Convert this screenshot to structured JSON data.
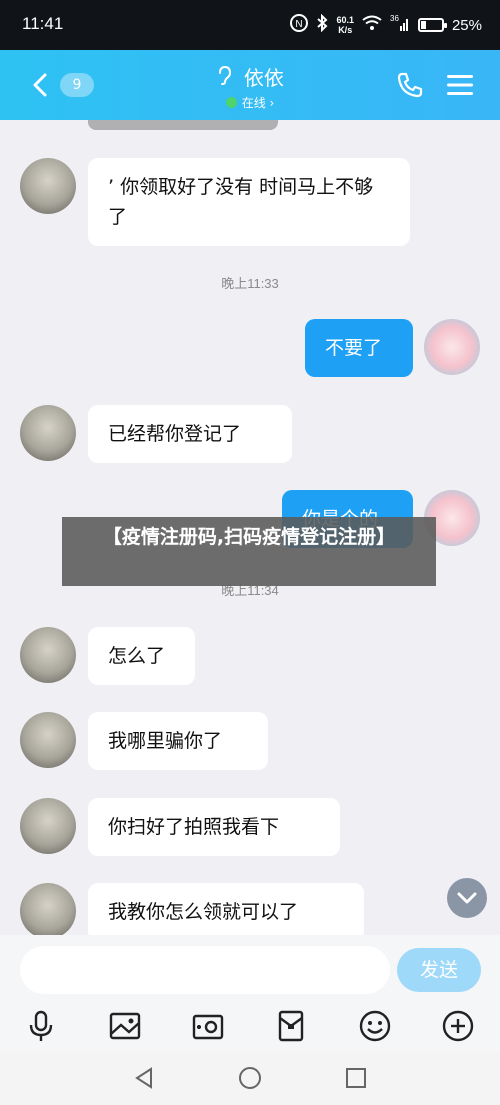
{
  "status_bar": {
    "time": "11:41",
    "net_speed_value": "60.1",
    "net_speed_unit": "K/s",
    "signal": "36",
    "battery_percent": "25%",
    "battery_level": 0.25
  },
  "header": {
    "unread_count": "9",
    "contact_name": "依依",
    "contact_status": "在线 ›"
  },
  "messages": [
    {
      "side": "in",
      "text": "’ 你领取好了没有  时间马上不够了"
    },
    {
      "side": "time",
      "text": "晚上11:33"
    },
    {
      "side": "out",
      "text": "不要了"
    },
    {
      "side": "in",
      "text": "已经帮你登记了"
    },
    {
      "side": "out",
      "text": "你是个的"
    },
    {
      "side": "time",
      "text": "晚上11:34"
    },
    {
      "side": "in",
      "text": "怎么了"
    },
    {
      "side": "in",
      "text": "我哪里骗你了"
    },
    {
      "side": "in",
      "text": "你扫好了拍照我看下"
    },
    {
      "side": "in",
      "text": "我教你怎么领就可以了"
    }
  ],
  "banner": {
    "text": "【疫情注册码,扫码疫情登记注册】"
  },
  "composer": {
    "placeholder": "",
    "send_label": "发送"
  },
  "toolbar_icons": [
    "microphone-icon",
    "image-icon",
    "camera-icon",
    "red-packet-icon",
    "emoji-icon",
    "plus-icon"
  ],
  "system_nav_icons": [
    "back-icon",
    "home-icon",
    "recents-icon"
  ],
  "colors": {
    "header_accent": "#2ec2f3",
    "outgoing_bubble": "#1ea0f5",
    "send_button": "#9ed9fa",
    "online_dot": "#4ed46b"
  }
}
